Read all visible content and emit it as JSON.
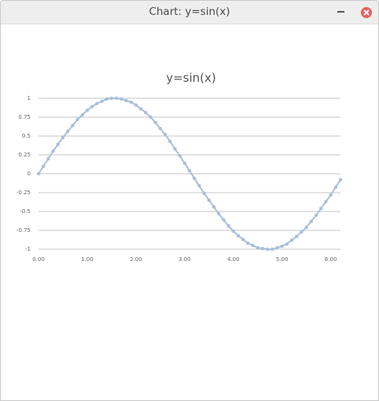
{
  "window": {
    "title": "Chart: y=sin(x)",
    "minimize_icon": "minimize-icon",
    "close_icon": "close-icon",
    "close_color": "#e85e5e"
  },
  "chart_data": {
    "type": "line",
    "title": "y=sin(x)",
    "xlabel": "",
    "ylabel": "",
    "xlim": [
      0,
      6.2
    ],
    "ylim": [
      -1,
      1
    ],
    "x_ticks": [
      "0.00",
      "1.00",
      "2.00",
      "3.00",
      "4.00",
      "5.00",
      "6.00"
    ],
    "y_ticks": [
      "1",
      "0.75",
      "0.5",
      "0.25",
      "0",
      "-0.25",
      "-0.5",
      "-0.75",
      "-1"
    ],
    "grid": "horizontal",
    "legend": "none",
    "series": [
      {
        "color": "#a9bfd9",
        "x": [
          0.0,
          0.1,
          0.2,
          0.3,
          0.4,
          0.5,
          0.6,
          0.7,
          0.8,
          0.9,
          1.0,
          1.1,
          1.2,
          1.3,
          1.4,
          1.5,
          1.6,
          1.7,
          1.8,
          1.9,
          2.0,
          2.1,
          2.2,
          2.3,
          2.4,
          2.5,
          2.6,
          2.7,
          2.8,
          2.9,
          3.0,
          3.1,
          3.2,
          3.3,
          3.4,
          3.5,
          3.6,
          3.7,
          3.8,
          3.9,
          4.0,
          4.1,
          4.2,
          4.3,
          4.4,
          4.5,
          4.6,
          4.7,
          4.8,
          4.9,
          5.0,
          5.1,
          5.2,
          5.3,
          5.4,
          5.5,
          5.6,
          5.7,
          5.8,
          5.9,
          6.0,
          6.1,
          6.2
        ],
        "y": [
          0.0,
          0.1,
          0.2,
          0.3,
          0.39,
          0.48,
          0.56,
          0.64,
          0.72,
          0.78,
          0.84,
          0.89,
          0.93,
          0.96,
          0.99,
          1.0,
          1.0,
          0.99,
          0.97,
          0.95,
          0.91,
          0.86,
          0.81,
          0.75,
          0.68,
          0.6,
          0.52,
          0.43,
          0.33,
          0.24,
          0.14,
          0.04,
          -0.06,
          -0.16,
          -0.26,
          -0.35,
          -0.44,
          -0.53,
          -0.61,
          -0.69,
          -0.76,
          -0.82,
          -0.87,
          -0.92,
          -0.95,
          -0.98,
          -0.99,
          -1.0,
          -1.0,
          -0.98,
          -0.96,
          -0.93,
          -0.88,
          -0.83,
          -0.77,
          -0.71,
          -0.63,
          -0.55,
          -0.46,
          -0.37,
          -0.28,
          -0.18,
          -0.08
        ]
      }
    ]
  }
}
